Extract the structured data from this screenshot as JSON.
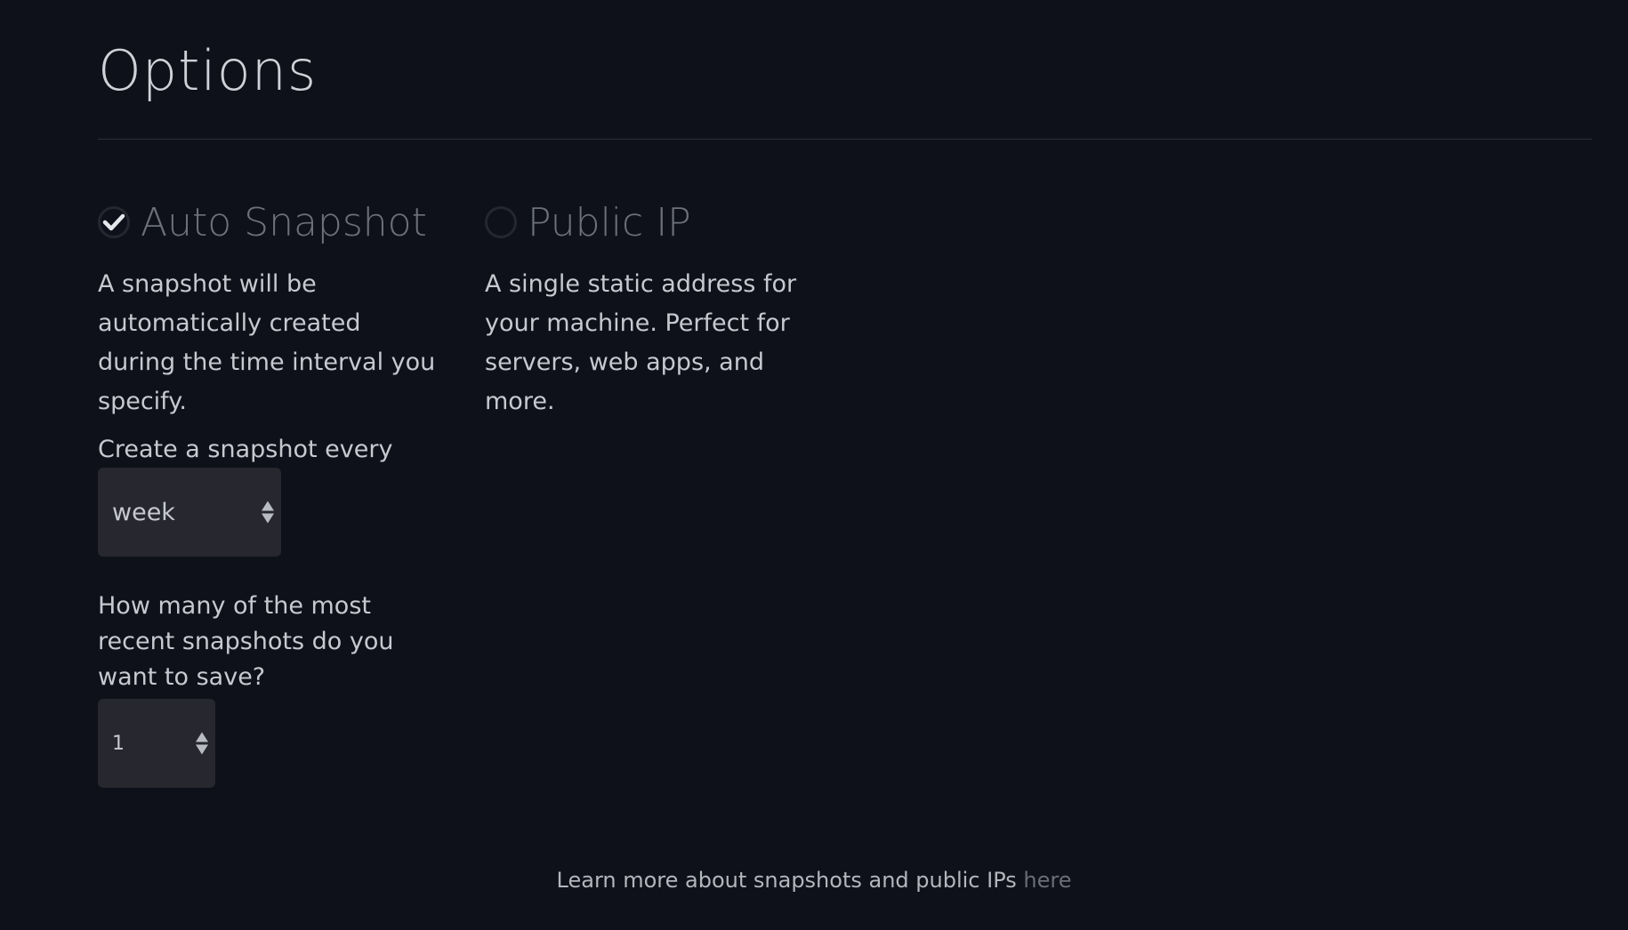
{
  "page": {
    "title": "Options"
  },
  "options": {
    "auto_snapshot": {
      "title": "Auto Snapshot",
      "checked": true,
      "description": "A snapshot will be automatically created during the time interval you specify.",
      "interval_label": "Create a snapshot every",
      "interval_value": "week",
      "retain_label": "How many of the most recent snapshots do you want to save?",
      "retain_value": "1"
    },
    "public_ip": {
      "title": "Public IP",
      "checked": false,
      "description": "A single static address for your machine. Perfect for servers, web apps, and more."
    }
  },
  "footer": {
    "text": "Learn more about snapshots and public IPs",
    "link_label": "here"
  },
  "colors": {
    "background": "#0e111a",
    "check_mark": "#e6e7ec",
    "circle_border": "#24272f",
    "select_bg": "#27272f"
  },
  "icons": {
    "checked": "checkmark-icon",
    "unchecked": "empty-circle-icon"
  }
}
